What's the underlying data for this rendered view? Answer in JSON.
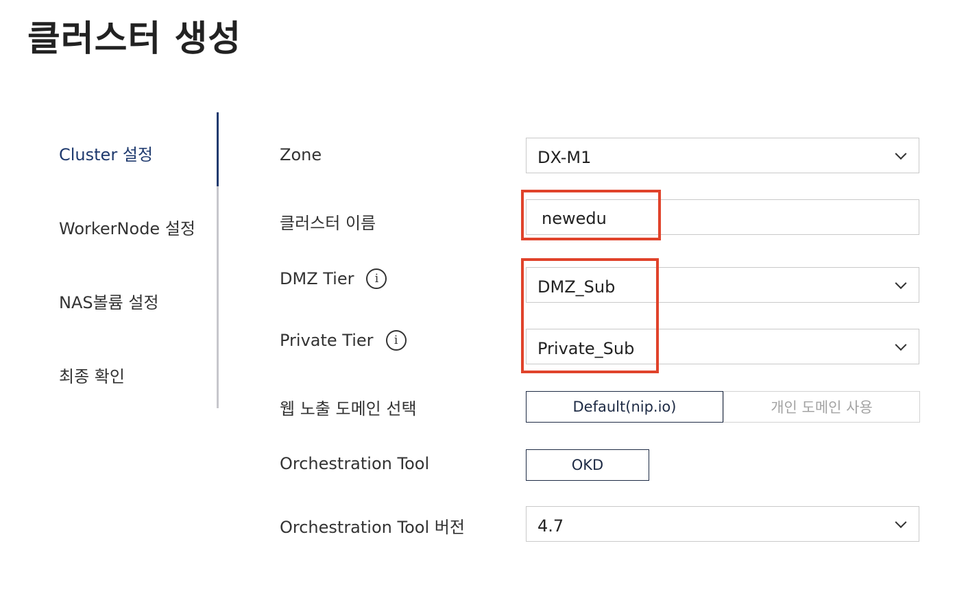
{
  "page": {
    "title": "클러스터 생성"
  },
  "steps": [
    {
      "label": "Cluster 설정",
      "active": true
    },
    {
      "label": "WorkerNode 설정",
      "active": false
    },
    {
      "label": "NAS볼륨 설정",
      "active": false
    },
    {
      "label": "최종 확인",
      "active": false
    }
  ],
  "form": {
    "zone": {
      "label": "Zone",
      "value": "DX-M1"
    },
    "cluster_name": {
      "label": "클러스터 이름",
      "value": "newedu"
    },
    "dmz_tier": {
      "label": "DMZ Tier",
      "value": "DMZ_Sub",
      "info_icon": "info-icon"
    },
    "private_tier": {
      "label": "Private Tier",
      "value": "Private_Sub",
      "info_icon": "info-icon"
    },
    "web_domain": {
      "label": "웹 노출 도메인 선택",
      "options": [
        "Default(nip.io)",
        "개인 도메인 사용"
      ],
      "selected": "Default(nip.io)"
    },
    "orchestration_tool": {
      "label": "Orchestration Tool",
      "value": "OKD"
    },
    "orchestration_version": {
      "label": "Orchestration Tool 버전",
      "value": "4.7"
    }
  },
  "colors": {
    "accent": "#1f3a6e",
    "highlight": "#e0432b",
    "border": "#c9c9c9"
  }
}
